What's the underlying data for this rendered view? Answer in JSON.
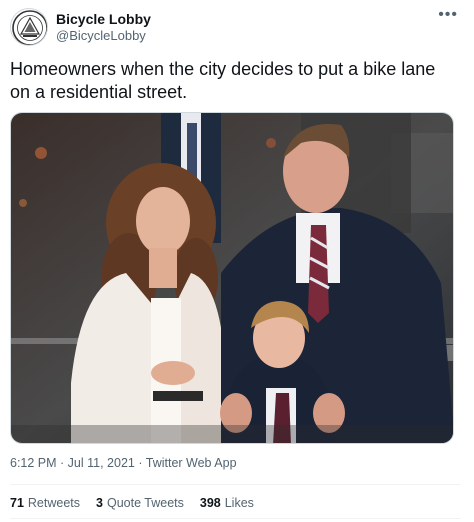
{
  "author": {
    "name": "Bicycle Lobby",
    "handle": "@BicycleLobby",
    "avatar_icon": "seal-logo-icon"
  },
  "more_icon": "more-horizontal-icon",
  "tweet_text": "Homeowners when the city decides to put a bike lane on a residential street.",
  "media": {
    "description_icon": "photo-icon"
  },
  "meta": {
    "time": "6:12 PM",
    "separator1": " · ",
    "date": "Jul 11, 2021",
    "separator2": " · ",
    "source": "Twitter Web App"
  },
  "stats": {
    "retweets_count": "71",
    "retweets_label": "Retweets",
    "quotes_count": "3",
    "quotes_label": "Quote Tweets",
    "likes_count": "398",
    "likes_label": "Likes"
  },
  "colors": {
    "text_primary": "#0f1419",
    "text_secondary": "#536471",
    "divider": "#eff3f4"
  }
}
